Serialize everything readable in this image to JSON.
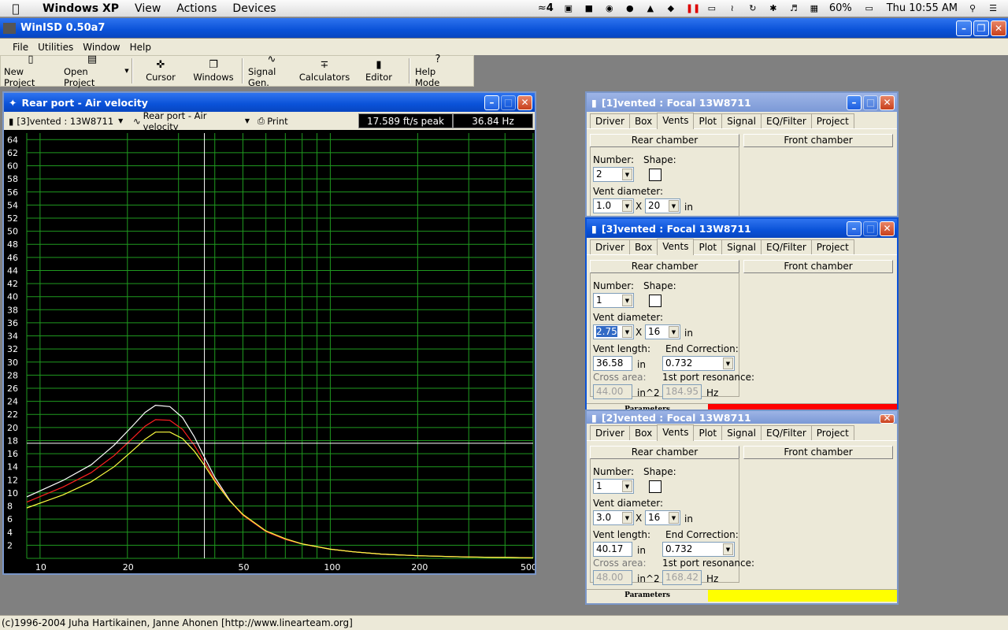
{
  "mac_menu": {
    "app": "Windows XP",
    "items": [
      "View",
      "Actions",
      "Devices"
    ],
    "clock": "Thu 10:55 AM",
    "battery": "60%",
    "tray_number": "4"
  },
  "app_title": "WinISD 0.50a7",
  "menu": [
    "File",
    "Utilities",
    "Window",
    "Help"
  ],
  "toolbar": [
    "New Project",
    "Open Project",
    "Cursor",
    "Windows",
    "Signal Gen.",
    "Calculators",
    "Editor",
    "Help Mode"
  ],
  "graph_window": {
    "title": "Rear port - Air velocity",
    "project_select": "[3]vented : 13W8711",
    "graph_select": "Rear port - Air velocity",
    "print_label": "Print",
    "readout_value": "17.589 ft/s peak",
    "readout_freq": "36.84 Hz"
  },
  "chart_data": {
    "type": "line",
    "title": "Rear port - Air velocity",
    "xlabel": "",
    "ylabel": "",
    "xscale": "log",
    "xlim": [
      9,
      500
    ],
    "ylim": [
      0,
      65
    ],
    "x_ticks": [
      10,
      20,
      50,
      100,
      200,
      500
    ],
    "y_ticks": [
      2,
      4,
      6,
      8,
      10,
      12,
      14,
      16,
      18,
      20,
      22,
      24,
      26,
      28,
      30,
      32,
      34,
      36,
      38,
      40,
      42,
      44,
      46,
      48,
      50,
      52,
      54,
      56,
      58,
      60,
      62,
      64
    ],
    "grid": true,
    "cursor": {
      "x": 36.84,
      "y": 17.589
    },
    "series": [
      {
        "color": "#ffffff",
        "x": [
          9,
          12,
          15,
          18,
          21,
          23,
          25,
          28,
          31,
          34,
          37,
          40,
          45,
          50,
          60,
          70,
          80,
          100,
          120,
          150,
          200,
          300,
          500
        ],
        "y": [
          9.4,
          11.9,
          14.3,
          17.3,
          20.4,
          22.3,
          23.4,
          23.2,
          21.5,
          18.6,
          15.3,
          12.4,
          8.9,
          6.6,
          4.1,
          2.9,
          2.2,
          1.4,
          1.0,
          0.65,
          0.4,
          0.2,
          0.08
        ]
      },
      {
        "color": "#ff2020",
        "x": [
          9,
          12,
          15,
          18,
          21,
          23,
          25,
          28,
          31,
          34,
          37,
          40,
          45,
          50,
          60,
          70,
          80,
          100,
          120,
          150,
          200,
          300,
          500
        ],
        "y": [
          8.6,
          10.9,
          13.1,
          15.7,
          18.5,
          20.2,
          21.2,
          21.1,
          19.7,
          17.3,
          14.6,
          12.0,
          8.8,
          6.6,
          4.1,
          2.9,
          2.2,
          1.4,
          1.0,
          0.65,
          0.4,
          0.2,
          0.08
        ]
      },
      {
        "color": "#ffff40",
        "x": [
          9,
          12,
          15,
          18,
          21,
          23,
          25,
          28,
          31,
          34,
          37,
          40,
          45,
          50,
          60,
          70,
          80,
          100,
          120,
          150,
          200,
          300,
          500
        ],
        "y": [
          7.7,
          9.7,
          11.7,
          14.0,
          16.6,
          18.2,
          19.3,
          19.3,
          18.3,
          16.4,
          14.1,
          11.8,
          8.8,
          6.7,
          4.2,
          3.0,
          2.2,
          1.4,
          1.0,
          0.65,
          0.4,
          0.2,
          0.08
        ]
      }
    ]
  },
  "project_windows": [
    {
      "title": "[1]vented : Focal 13W8711",
      "tabs": [
        "Driver",
        "Box",
        "Vents",
        "Plot",
        "Signal",
        "EQ/Filter",
        "Project"
      ],
      "selected_tab": "Vents",
      "rear": "Rear chamber",
      "front": "Front chamber",
      "number_label": "Number:",
      "number": "2",
      "shape_label": "Shape:",
      "vd_label": "Vent diameter:",
      "vd": "1.0",
      "x_sep": "X",
      "vd2": "20",
      "unit_in": "in"
    },
    {
      "title": "[3]vented : Focal 13W8711",
      "tabs": [
        "Driver",
        "Box",
        "Vents",
        "Plot",
        "Signal",
        "EQ/Filter",
        "Project"
      ],
      "selected_tab": "Vents",
      "rear": "Rear chamber",
      "front": "Front chamber",
      "number_label": "Number:",
      "number": "1",
      "shape_label": "Shape:",
      "vd_label": "Vent diameter:",
      "vd": "2.75",
      "x_sep": "X",
      "vd2": "16",
      "unit_in": "in",
      "vl_label": "Vent length:",
      "vl": "36.58",
      "ec_label": "End Correction:",
      "ec": "0.732",
      "ca_label": "Cross area:",
      "ca": "44.00",
      "ca_unit": "in^2",
      "pr_label": "1st port resonance:",
      "pr": "184.95",
      "pr_unit": "Hz",
      "status": "Parameters",
      "status_color": "#ff0000"
    },
    {
      "title": "[2]vented : Focal 13W8711",
      "tabs": [
        "Driver",
        "Box",
        "Vents",
        "Plot",
        "Signal",
        "EQ/Filter",
        "Project"
      ],
      "selected_tab": "Vents",
      "rear": "Rear chamber",
      "front": "Front chamber",
      "number_label": "Number:",
      "number": "1",
      "shape_label": "Shape:",
      "vd_label": "Vent diameter:",
      "vd": "3.0",
      "x_sep": "X",
      "vd2": "16",
      "unit_in": "in",
      "vl_label": "Vent length:",
      "vl": "40.17",
      "ec_label": "End Correction:",
      "ec": "0.732",
      "ca_label": "Cross area:",
      "ca": "48.00",
      "ca_unit": "in^2",
      "pr_label": "1st port resonance:",
      "pr": "168.42",
      "pr_unit": "Hz",
      "status": "Parameters",
      "status_color": "#ffff00"
    }
  ],
  "footer": "(c)1996-2004 Juha Hartikainen, Janne Ahonen [http://www.linearteam.org]"
}
